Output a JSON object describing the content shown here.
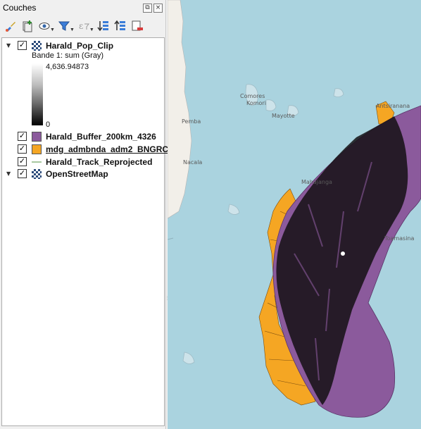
{
  "panel": {
    "title": "Couches",
    "title_buttons": [
      "⧉",
      "×"
    ]
  },
  "toolbar": {
    "icons": [
      "paint-brush-icon",
      "add-group-icon",
      "eye-icon",
      "filter-icon",
      "expression-filter-icon",
      "expand-all-icon",
      "collapse-all-icon",
      "remove-layer-icon"
    ]
  },
  "layers": [
    {
      "name": "Harald_Pop_Clip",
      "checked": true,
      "expanded": true,
      "type": "raster"
    },
    {
      "name": "Harald_Buffer_200km_4326",
      "checked": true,
      "type": "polygon",
      "color": "#8b5a9c"
    },
    {
      "name": "mdg_admbnda_adm2_BNGRC",
      "checked": true,
      "type": "polygon",
      "color": "#f5a623"
    },
    {
      "name": "Harald_Track_Reprojected",
      "checked": true,
      "type": "line",
      "color": "#a8c8a0"
    },
    {
      "name": "OpenStreetMap",
      "checked": true,
      "expanded": true,
      "type": "tile"
    }
  ],
  "raster_legend": {
    "band": "Bande 1: sum (Gray)",
    "max": "4,636.94873",
    "min": "0"
  },
  "map_labels": {
    "comores": "Comores",
    "komori": "Komori",
    "mayotte": "Mayotte",
    "antsiranana": "Antsiranana",
    "pemba": "Pemba",
    "nacala": "Nacala",
    "mahajanga": "Mahajanga",
    "toamasina": "Toamasina"
  },
  "colors": {
    "sea": "#aad3df",
    "land": "#f2efe9",
    "buffer": "#8b5a9c",
    "admin": "#f5a623",
    "population": "#000000"
  }
}
